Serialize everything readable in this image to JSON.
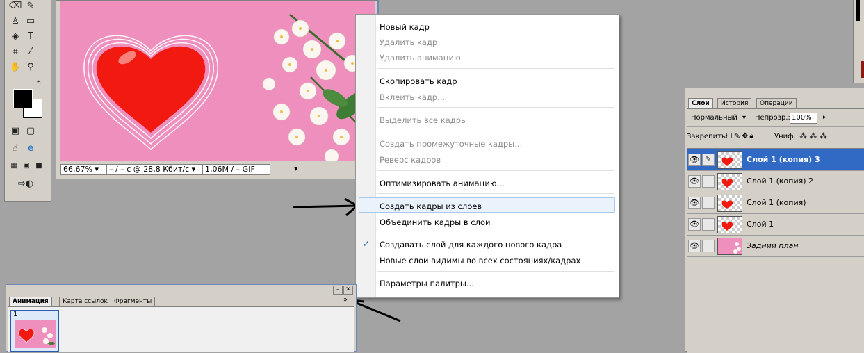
{
  "toolbox": {
    "tools": [
      "eraser-icon",
      "gradient-icon",
      "stamp-icon",
      "rect-icon",
      "bucket-icon",
      "type-icon",
      "crop-icon",
      "eyedropper-icon",
      "hand-icon",
      "zoom-icon",
      "hand2-icon",
      "screen-mode-icon",
      "jump-icon",
      "browser-icon",
      "std-mode-icon",
      "quickmask-icon",
      "view-icon",
      "imageready-icon"
    ],
    "type_glyph": "T"
  },
  "document": {
    "zoom": "66,67% ▾",
    "speed": "– / – с @ 28,8 Кбит/с ▾",
    "size": "1,06M / – GIF",
    "size_arrow": "▾"
  },
  "menu": {
    "items": [
      {
        "label": "Новый кадр",
        "enabled": true
      },
      {
        "label": "Удалить кадр",
        "enabled": false
      },
      {
        "label": "Удалить анимацию",
        "enabled": false
      },
      {
        "label": "Скопировать кадр",
        "enabled": true
      },
      {
        "label": "Вклеить кадр...",
        "enabled": false
      },
      {
        "label": "Выделить все кадры",
        "enabled": false
      },
      {
        "label": "Создать промежуточные кадры...",
        "enabled": false
      },
      {
        "label": "Реверс кадров",
        "enabled": false
      },
      {
        "label": "Оптимизировать анимацию...",
        "enabled": true
      },
      {
        "label": "Создать кадры из слоев",
        "enabled": true,
        "highlighted": true
      },
      {
        "label": "Объединить кадры в слои",
        "enabled": true
      },
      {
        "label": "Создавать слой для каждого нового кадра",
        "enabled": true,
        "checked": true
      },
      {
        "label": "Новые слои видимы во всех состояниях/кадрах",
        "enabled": true
      },
      {
        "label": "Параметры палитры...",
        "enabled": true
      }
    ],
    "check_glyph": "✓"
  },
  "animation_panel": {
    "tabs": [
      "Анимация",
      "Карта ссылок",
      "Фрагменты"
    ],
    "frame_number": "1",
    "menu_arrow": "»"
  },
  "layers_panel": {
    "tabs": [
      "Слои",
      "История",
      "Операции"
    ],
    "blend_mode": "Нормальный",
    "opacity_label": "Непрозр.:",
    "opacity_value": "100%",
    "lock_label": "Закрепить:",
    "unify_label": "Униф.:",
    "layers": [
      {
        "name": "Слой 1 (копия) 3",
        "selected": true
      },
      {
        "name": "Слой 1 (копия) 2",
        "selected": false
      },
      {
        "name": "Слой 1 (копия)",
        "selected": false
      },
      {
        "name": "Слой 1",
        "selected": false
      },
      {
        "name": "Задний план",
        "selected": false,
        "background": true
      }
    ]
  },
  "colors": {
    "canvas_pink": "#ee8fbd",
    "heart_red": "#f21a10",
    "selection_blue": "#316ac5",
    "menu_highlight": "#eaf2fb"
  }
}
